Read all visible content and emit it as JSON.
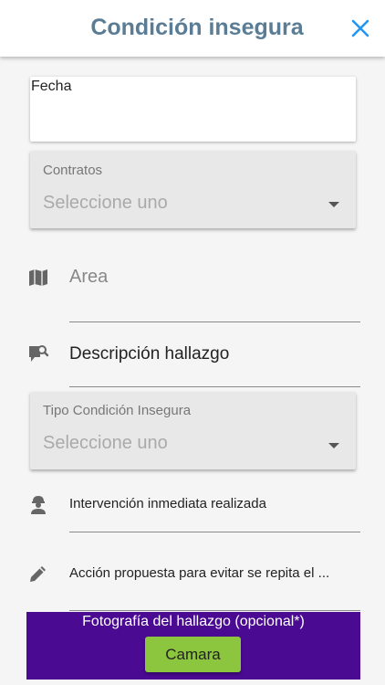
{
  "header": {
    "title": "Condición insegura",
    "close_icon": "close-icon"
  },
  "form": {
    "fecha_label": "Fecha",
    "contratos": {
      "label": "Contratos",
      "value": "Seleccione uno"
    },
    "area": {
      "label": "Area",
      "icon": "map-icon"
    },
    "descripcion": {
      "label": "Descripción hallazgo",
      "icon": "comment-search-icon"
    },
    "tipo": {
      "label": "Tipo Condición Insegura",
      "value": "Seleccione uno"
    },
    "intervencion": {
      "label": "Intervención inmediata realizada",
      "icon": "worker-icon"
    },
    "accion": {
      "label": "Acción propuesta para evitar se repita el ...",
      "icon": "pencil-icon"
    }
  },
  "photo": {
    "title": "Fotografía del hallazgo (opcional*)",
    "button": "Camara"
  },
  "colors": {
    "accent": "#2196f3",
    "title": "#5a7d95",
    "photo_bg": "#4a0a92",
    "button_bg": "#8cc63f"
  }
}
